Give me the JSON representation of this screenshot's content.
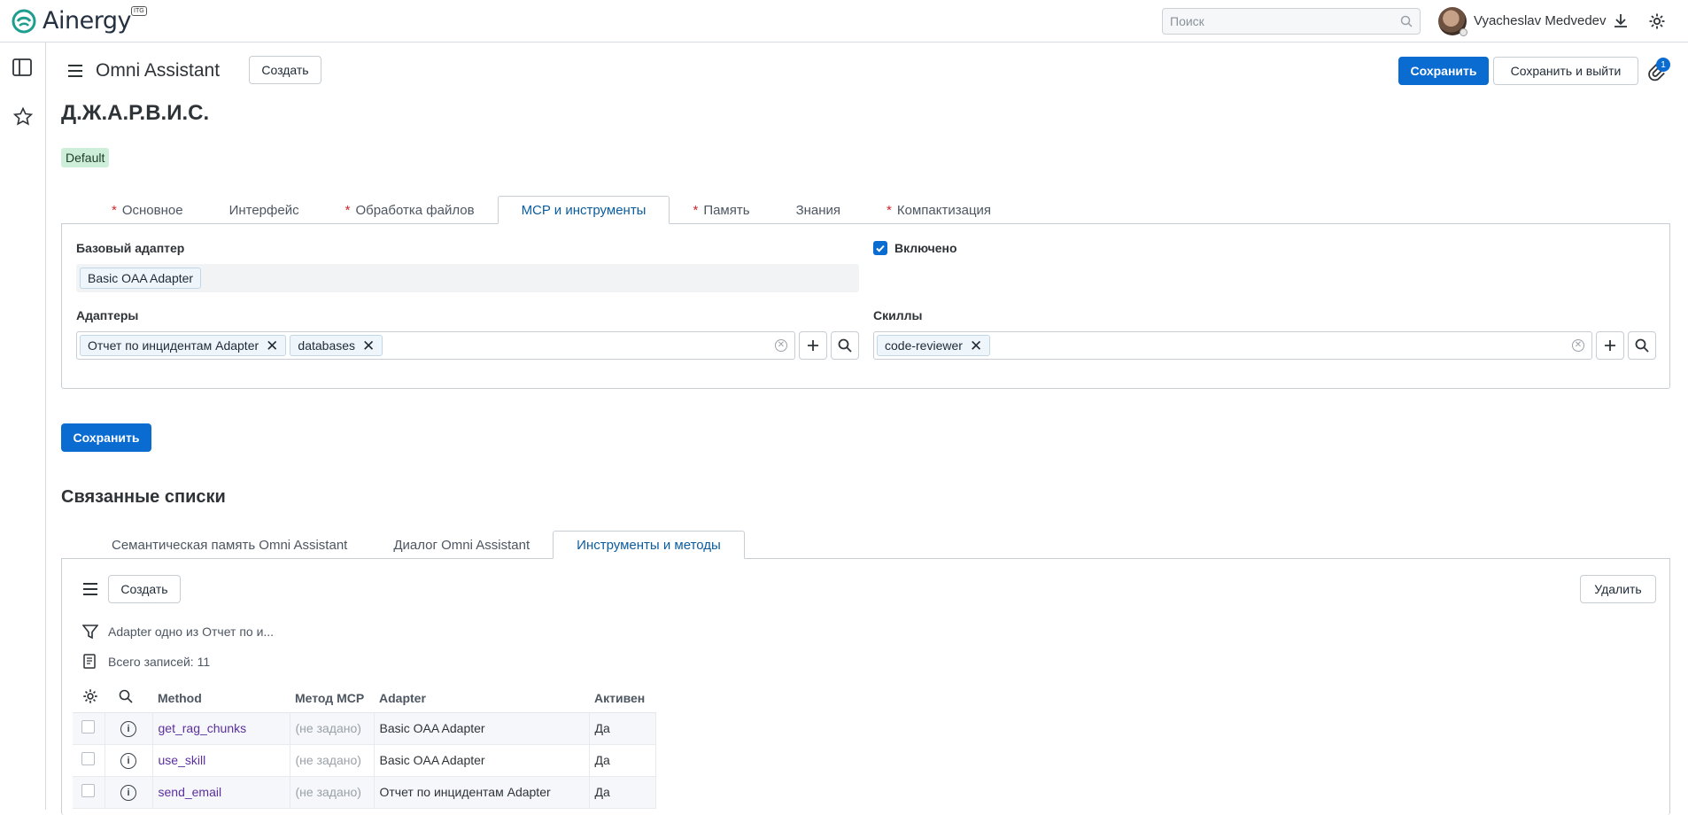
{
  "app": {
    "logo_text": "Ainergy",
    "logo_badge": "ITG"
  },
  "topbar": {
    "search_placeholder": "Поиск",
    "user_name": "Vyacheslav Medvedev"
  },
  "form": {
    "title": "Omni Assistant",
    "create_label": "Создать",
    "save_label": "Сохранить",
    "save_exit_label": "Сохранить и выйти",
    "attachments_count": "1",
    "record_title": "Д.Ж.А.Р.В.И.С.",
    "badge": "Default"
  },
  "tabs": [
    {
      "label": "Основное",
      "required": "*"
    },
    {
      "label": "Интерфейс",
      "required": ""
    },
    {
      "label": "Обработка файлов",
      "required": "*"
    },
    {
      "label": "MCP и инструменты",
      "required": "",
      "active": true
    },
    {
      "label": "Память",
      "required": "*"
    },
    {
      "label": "Знания",
      "required": ""
    },
    {
      "label": "Компактизация",
      "required": "*"
    }
  ],
  "panel": {
    "base_adapter_label": "Базовый адаптер",
    "base_adapter_value": "Basic OAA Adapter",
    "enabled_label": "Включено",
    "enabled": true,
    "adapters_label": "Адаптеры",
    "adapters": [
      "Отчет по инцидентам Adapter",
      "databases"
    ],
    "skills_label": "Скиллы",
    "skills": [
      "code-reviewer"
    ]
  },
  "save_button": "Сохранить",
  "related": {
    "heading": "Связанные списки",
    "tabs": [
      {
        "label": "Семантическая память Omni Assistant"
      },
      {
        "label": "Диалог Omni Assistant"
      },
      {
        "label": "Инструменты и методы",
        "active": true
      }
    ],
    "create_label": "Создать",
    "delete_label": "Удалить",
    "filter_text": "Adapter одно из Отчет по и...",
    "total_text": "Всего записей: 11",
    "columns": [
      "Method",
      "Метод MCP",
      "Adapter",
      "Активен"
    ],
    "rows": [
      {
        "method": "get_rag_chunks",
        "mcp": "(не задано)",
        "adapter": "Basic OAA Adapter",
        "active": "Да"
      },
      {
        "method": "use_skill",
        "mcp": "(не задано)",
        "adapter": "Basic OAA Adapter",
        "active": "Да"
      },
      {
        "method": "send_email",
        "mcp": "(не задано)",
        "adapter": "Отчет по инцидентам Adapter",
        "active": "Да"
      }
    ]
  },
  "colors": {
    "primary": "#0a6bd0",
    "required": "#d0262c",
    "active_tab": "#0b5c9e",
    "badge_bg": "#cdeed8"
  }
}
